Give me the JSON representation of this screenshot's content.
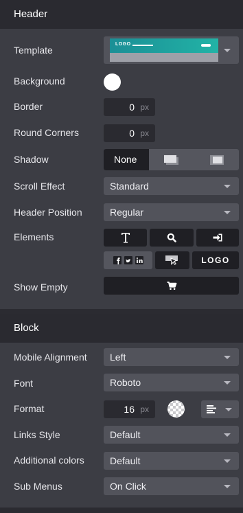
{
  "header_section": {
    "title": "Header",
    "template": {
      "label": "Template",
      "preview_logo": "LOGO"
    },
    "background": {
      "label": "Background",
      "color": "#ffffff"
    },
    "border": {
      "label": "Border",
      "value": "0",
      "unit": "px"
    },
    "round_corners": {
      "label": "Round Corners",
      "value": "0",
      "unit": "px"
    },
    "shadow": {
      "label": "Shadow",
      "options": [
        "None",
        "shadow-small-icon",
        "shadow-large-icon"
      ],
      "selected": "None"
    },
    "scroll_effect": {
      "label": "Scroll Effect",
      "value": "Standard"
    },
    "header_position": {
      "label": "Header Position",
      "value": "Regular"
    },
    "elements": {
      "label": "Elements",
      "icons": [
        "text-icon",
        "search-icon",
        "login-icon",
        "social-icons",
        "cursor-icon",
        "logo-icon"
      ],
      "logo_text": "LOGO"
    },
    "show_empty": {
      "label": "Show Empty",
      "icon": "cart-icon"
    }
  },
  "block_section": {
    "title": "Block",
    "mobile_alignment": {
      "label": "Mobile Alignment",
      "value": "Left"
    },
    "font": {
      "label": "Font",
      "value": "Roboto"
    },
    "format": {
      "label": "Format",
      "value": "16",
      "unit": "px",
      "align_icon": "align-left-icon"
    },
    "links_style": {
      "label": "Links Style",
      "value": "Default"
    },
    "additional_colors": {
      "label": "Additional colors",
      "value": "Default"
    },
    "sub_menus": {
      "label": "Sub Menus",
      "value": "On Click"
    }
  },
  "colors": {
    "panel": "#3c3d44",
    "header_bar": "#2a2a30",
    "accent_teal": "#1fa3a0"
  }
}
